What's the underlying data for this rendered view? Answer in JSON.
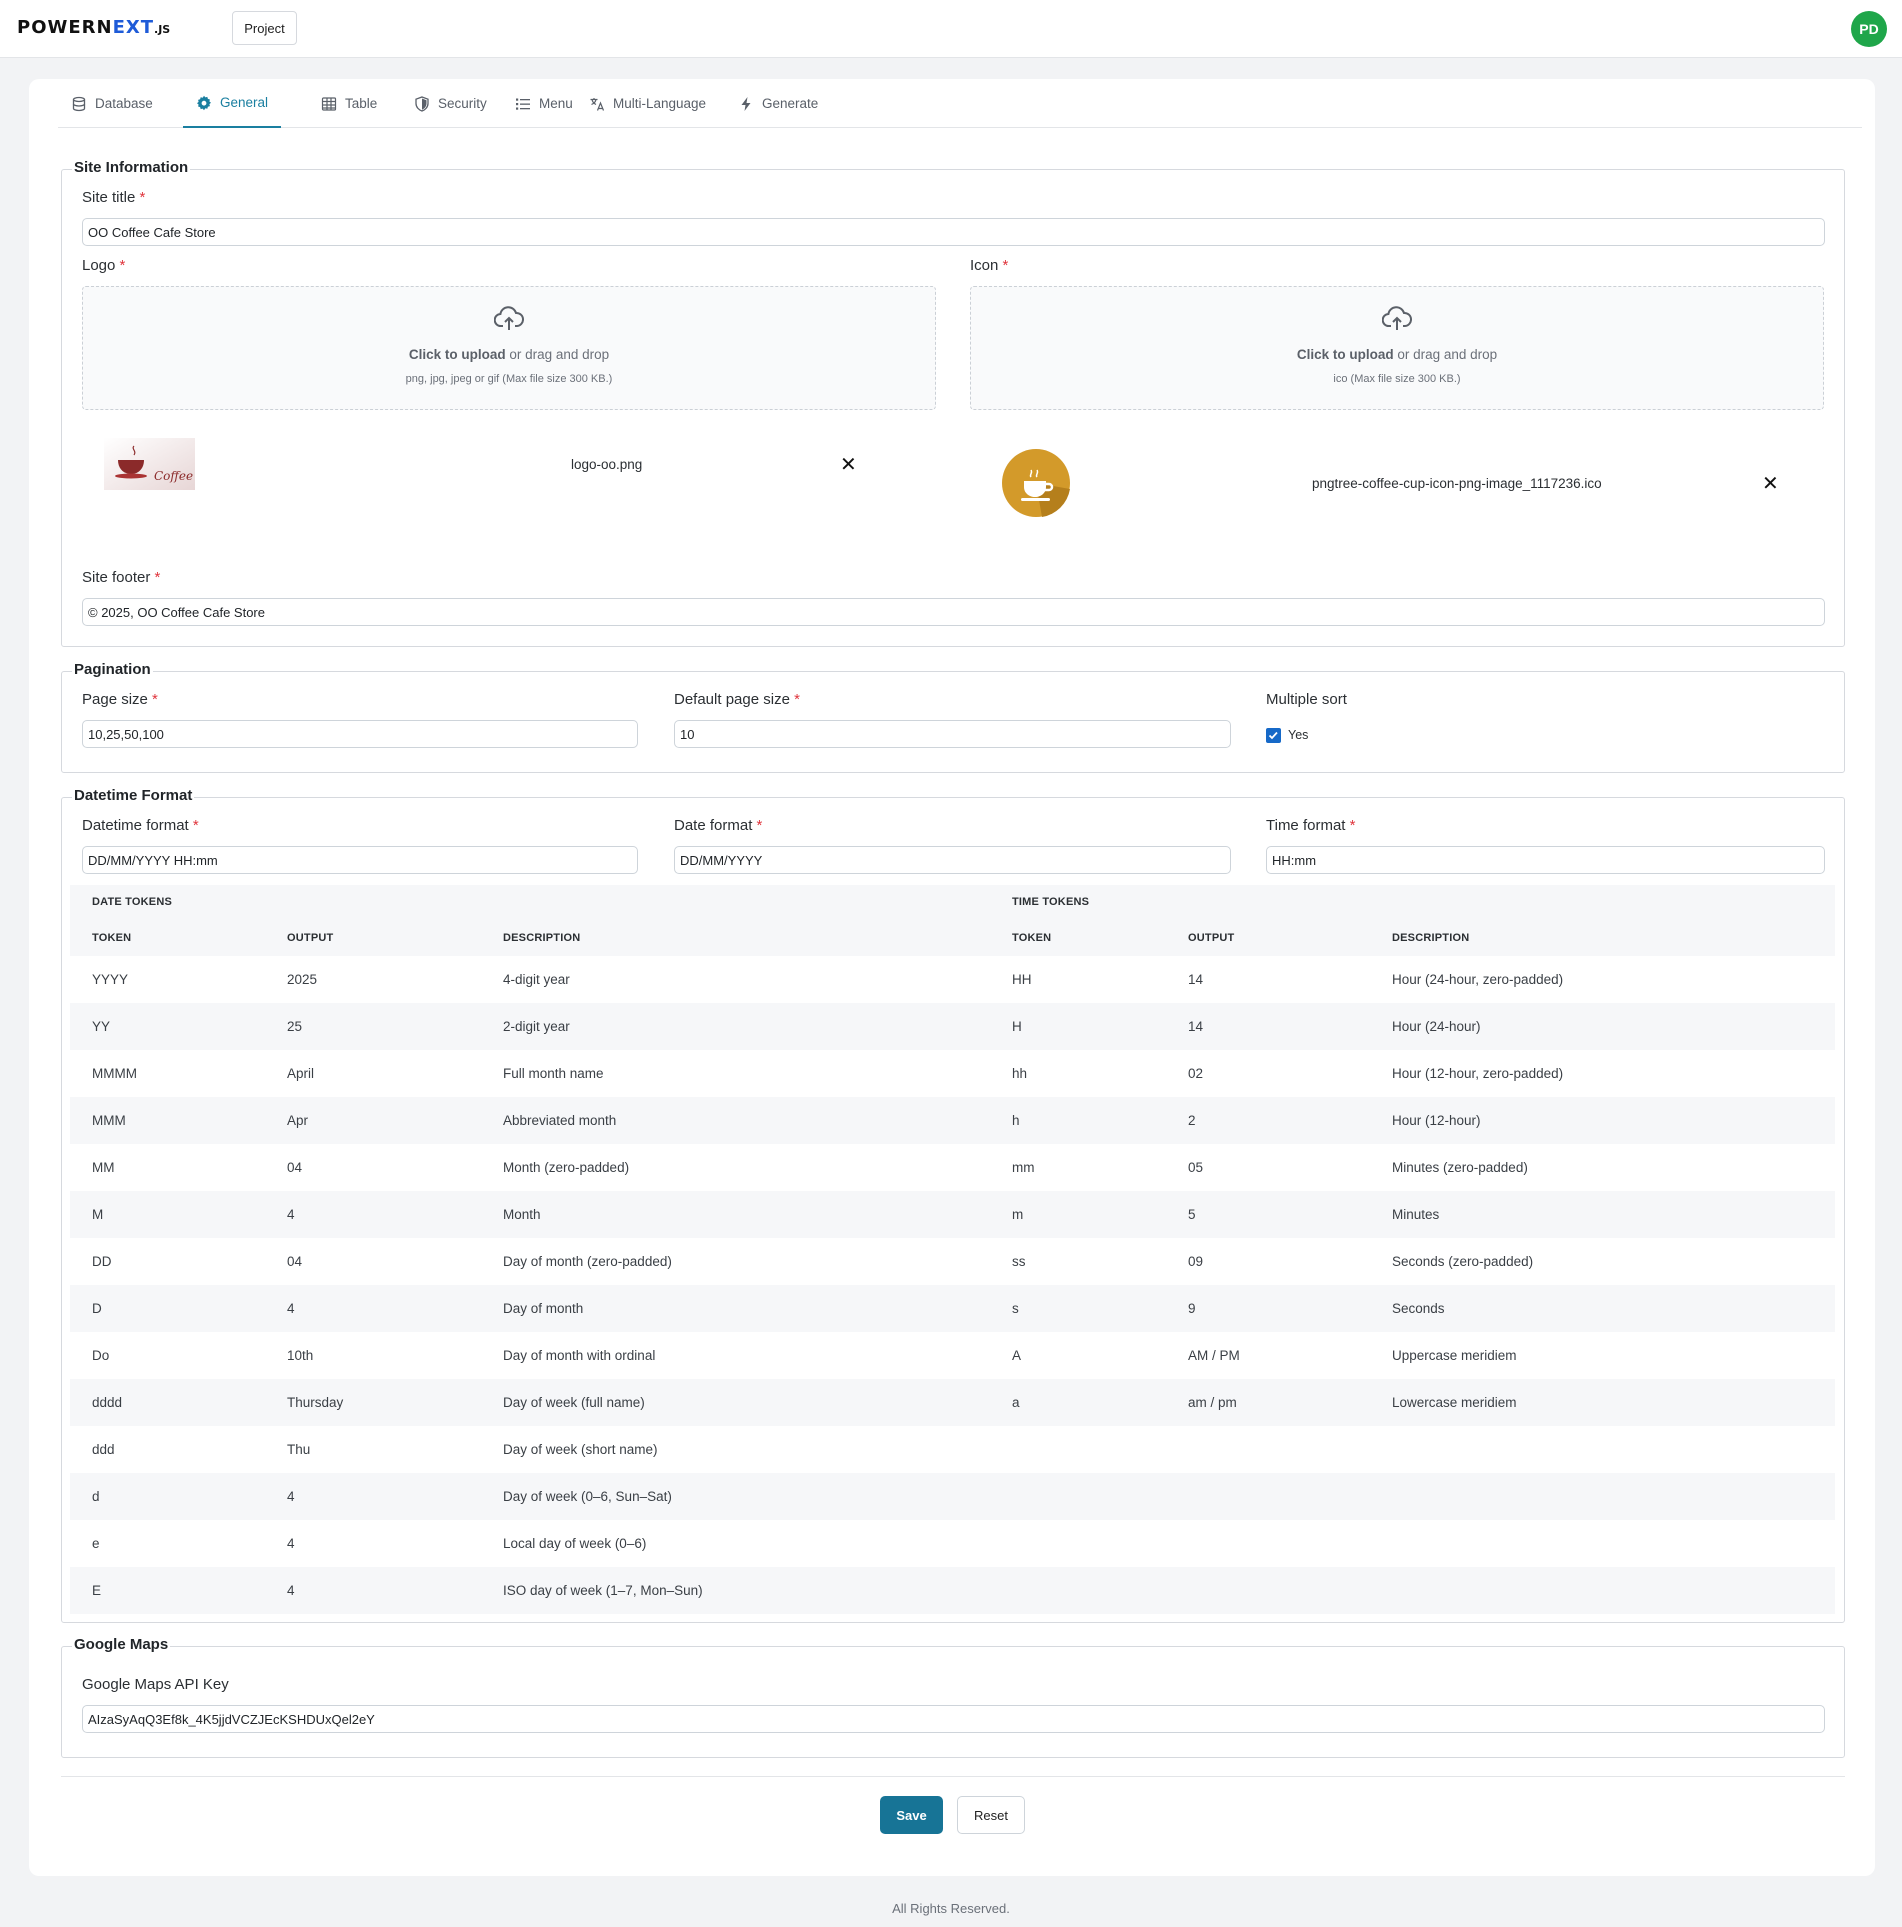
{
  "header": {
    "brand_main": "POWERN",
    "brand_accent": "EXT",
    "brand_suffix": ".JS",
    "project_label": "Project",
    "avatar_initials": "PD"
  },
  "tabs": [
    {
      "label": "Database",
      "icon": "database-icon",
      "active": false
    },
    {
      "label": "General",
      "icon": "gear-icon",
      "active": true
    },
    {
      "label": "Table",
      "icon": "table-icon",
      "active": false
    },
    {
      "label": "Security",
      "icon": "shield-icon",
      "active": false
    },
    {
      "label": "Menu",
      "icon": "list-icon",
      "active": false
    },
    {
      "label": "Multi-Language",
      "icon": "translate-icon",
      "active": false
    },
    {
      "label": "Generate",
      "icon": "bolt-icon",
      "active": false
    }
  ],
  "site_info": {
    "legend": "Site Information",
    "title_label": "Site title",
    "title_value": "OO Coffee Cafe Store",
    "logo_label": "Logo",
    "icon_label": "Icon",
    "upload_link": "Click to upload",
    "upload_rest": " or drag and drop",
    "logo_hint": "png, jpg, jpeg or gif (Max file size 300 KB.)",
    "icon_hint": "ico (Max file size 300 KB.)",
    "logo_file": "logo-oo.png",
    "logo_thumb_text": "Coffee Shop",
    "icon_file": "pngtree-coffee-cup-icon-png-image_1117236.ico",
    "footer_label": "Site footer",
    "footer_value": "© 2025, OO Coffee Cafe Store",
    "required_mark": "*"
  },
  "pagination": {
    "legend": "Pagination",
    "page_size_label": "Page size",
    "page_size_value": "10,25,50,100",
    "default_label": "Default page size",
    "default_value": "10",
    "multi_sort_label": "Multiple sort",
    "multi_sort_option": "Yes",
    "multi_sort_checked": true
  },
  "datetime": {
    "legend": "Datetime Format",
    "datetime_label": "Datetime format",
    "datetime_value": "DD/MM/YYYY HH:mm",
    "date_label": "Date format",
    "date_value": "DD/MM/YYYY",
    "time_label": "Time format",
    "time_value": "HH:mm",
    "date_tokens_title": "DATE TOKENS",
    "time_tokens_title": "TIME TOKENS",
    "columns": [
      "TOKEN",
      "OUTPUT",
      "DESCRIPTION"
    ],
    "rows": [
      {
        "d_token": "YYYY",
        "d_output": "2025",
        "d_desc": "4-digit year",
        "t_token": "HH",
        "t_output": "14",
        "t_desc": "Hour (24-hour, zero-padded)"
      },
      {
        "d_token": "YY",
        "d_output": "25",
        "d_desc": "2-digit year",
        "t_token": "H",
        "t_output": "14",
        "t_desc": "Hour (24-hour)"
      },
      {
        "d_token": "MMMM",
        "d_output": "April",
        "d_desc": "Full month name",
        "t_token": "hh",
        "t_output": "02",
        "t_desc": "Hour (12-hour, zero-padded)"
      },
      {
        "d_token": "MMM",
        "d_output": "Apr",
        "d_desc": "Abbreviated month",
        "t_token": "h",
        "t_output": "2",
        "t_desc": "Hour (12-hour)"
      },
      {
        "d_token": "MM",
        "d_output": "04",
        "d_desc": "Month (zero-padded)",
        "t_token": "mm",
        "t_output": "05",
        "t_desc": "Minutes (zero-padded)"
      },
      {
        "d_token": "M",
        "d_output": "4",
        "d_desc": "Month",
        "t_token": "m",
        "t_output": "5",
        "t_desc": "Minutes"
      },
      {
        "d_token": "DD",
        "d_output": "04",
        "d_desc": "Day of month (zero-padded)",
        "t_token": "ss",
        "t_output": "09",
        "t_desc": "Seconds (zero-padded)"
      },
      {
        "d_token": "D",
        "d_output": "4",
        "d_desc": "Day of month",
        "t_token": "s",
        "t_output": "9",
        "t_desc": "Seconds"
      },
      {
        "d_token": "Do",
        "d_output": "10th",
        "d_desc": "Day of month with ordinal",
        "t_token": "A",
        "t_output": "AM / PM",
        "t_desc": "Uppercase meridiem"
      },
      {
        "d_token": "dddd",
        "d_output": "Thursday",
        "d_desc": "Day of week (full name)",
        "t_token": "a",
        "t_output": "am / pm",
        "t_desc": "Lowercase meridiem"
      },
      {
        "d_token": "ddd",
        "d_output": "Thu",
        "d_desc": "Day of week (short name)",
        "t_token": "",
        "t_output": "",
        "t_desc": ""
      },
      {
        "d_token": "d",
        "d_output": "4",
        "d_desc": "Day of week (0–6, Sun–Sat)",
        "t_token": "",
        "t_output": "",
        "t_desc": ""
      },
      {
        "d_token": "e",
        "d_output": "4",
        "d_desc": "Local day of week (0–6)",
        "t_token": "",
        "t_output": "",
        "t_desc": ""
      },
      {
        "d_token": "E",
        "d_output": "4",
        "d_desc": "ISO day of week (1–7, Mon–Sun)",
        "t_token": "",
        "t_output": "",
        "t_desc": ""
      }
    ]
  },
  "google_maps": {
    "legend": "Google Maps",
    "key_label": "Google Maps API Key",
    "key_value": "AIzaSyAqQ3Ef8k_4K5jjdVCZJEcKSHDUxQel2eY"
  },
  "actions": {
    "save_label": "Save",
    "reset_label": "Reset"
  },
  "footer": {
    "text": "All Rights Reserved."
  },
  "colors": {
    "accent": "#1a7fa0",
    "save_button": "#177496",
    "required": "#e0353d",
    "avatar": "#1fa64a",
    "checkbox": "#1669c8"
  }
}
